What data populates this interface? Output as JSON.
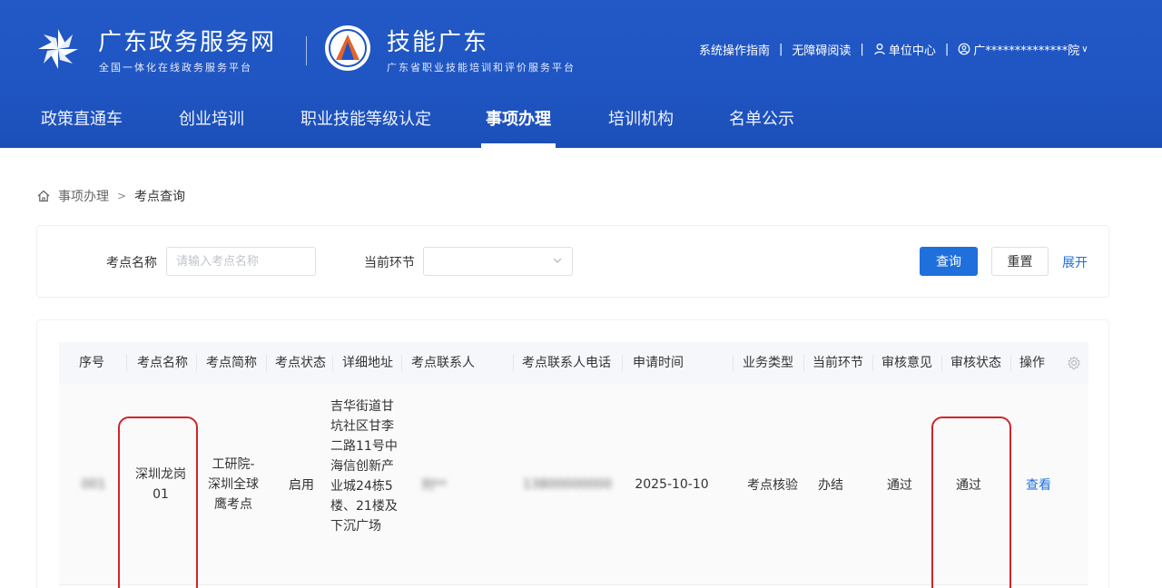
{
  "header": {
    "site_title": "广东政务服务网",
    "site_subtitle": "全国一体化在线政务服务平台",
    "brand_title": "技能广东",
    "brand_subtitle": "广东省职业技能培训和评价服务平台",
    "links": {
      "guide": "系统操作指南",
      "accessible": "无障碍阅读",
      "unit_center": "单位中心",
      "user_name": "广**************院"
    }
  },
  "nav": {
    "items": [
      {
        "label": "政策直通车"
      },
      {
        "label": "创业培训"
      },
      {
        "label": "职业技能等级认定"
      },
      {
        "label": "事项办理"
      },
      {
        "label": "培训机构"
      },
      {
        "label": "名单公示"
      }
    ],
    "active_index": 3
  },
  "breadcrumb": {
    "parent": "事项办理",
    "current": "考点查询"
  },
  "search": {
    "name_label": "考点名称",
    "name_placeholder": "请输入考点名称",
    "name_value": "",
    "stage_label": "当前环节",
    "stage_value": "",
    "query_label": "查询",
    "reset_label": "重置",
    "expand_label": "展开"
  },
  "table": {
    "columns": [
      "序号",
      "考点名称",
      "考点简称",
      "考点状态",
      "详细地址",
      "考点联系人",
      "考点联系人电话",
      "申请时间",
      "业务类型",
      "当前环节",
      "审核意见",
      "审核状态",
      "操作"
    ],
    "rows": [
      {
        "index": "001",
        "name": "深圳龙岗01",
        "short_name": "工研院-深圳全球鹰考点",
        "status": "启用",
        "address": "吉华街道甘坑社区甘李二路11号中海信创新产业城24栋5楼、21楼及下沉广场",
        "contact": "刘**",
        "phone": "13800000000",
        "apply_time": "2025-10-10",
        "biz_type": "考点核验",
        "stage": "办结",
        "opinion": "通过",
        "audit_status": "通过",
        "action": "查看"
      }
    ]
  },
  "colors": {
    "header_blue": "#2259c6",
    "primary": "#1f6fdc",
    "annotation_red": "#d0252b"
  }
}
